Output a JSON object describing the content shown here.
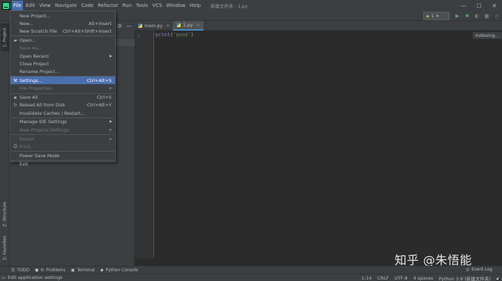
{
  "menubar": {
    "items": [
      "File",
      "Edit",
      "View",
      "Navigate",
      "Code",
      "Refactor",
      "Run",
      "Tools",
      "VCS",
      "Window",
      "Help"
    ],
    "window_title": "新建文件夹 - 1.py"
  },
  "window_controls": {
    "minimize": "—",
    "maximize": "☐",
    "close": "✕"
  },
  "toolbar": {
    "run_config": "1"
  },
  "left_tabs": {
    "project": "1: Project",
    "structure": "Z: Structure",
    "favorites": "2: Favorites"
  },
  "editor": {
    "tabs": [
      "main.py",
      "1.py"
    ],
    "line_number": "1",
    "code": {
      "fn": "print",
      "open": "(",
      "str": "'good'",
      "close": ")"
    },
    "indexing": "Indexing..."
  },
  "file_menu": [
    {
      "label": "New Project...",
      "shortcut": "",
      "icon": "",
      "disabled": false,
      "submenu": false
    },
    {
      "label": "New...",
      "shortcut": "Alt+Insert",
      "icon": "",
      "disabled": false,
      "submenu": false
    },
    {
      "label": "New Scratch File",
      "shortcut": "Ctrl+Alt+Shift+Insert",
      "icon": "",
      "disabled": false,
      "submenu": false
    },
    {
      "label": "Open...",
      "shortcut": "",
      "icon": "folder-icon",
      "disabled": false,
      "submenu": false
    },
    {
      "label": "Save As...",
      "shortcut": "",
      "icon": "",
      "disabled": true,
      "submenu": false
    },
    {
      "label": "Open Recent",
      "shortcut": "",
      "icon": "",
      "disabled": false,
      "submenu": true
    },
    {
      "label": "Close Project",
      "shortcut": "",
      "icon": "",
      "disabled": false,
      "submenu": false
    },
    {
      "label": "Rename Project...",
      "shortcut": "",
      "icon": "",
      "disabled": false,
      "submenu": false
    },
    {
      "label": "Settings...",
      "shortcut": "Ctrl+Alt+S",
      "icon": "wrench-icon",
      "disabled": false,
      "submenu": false,
      "selected": true
    },
    {
      "label": "File Properties",
      "shortcut": "",
      "icon": "",
      "disabled": true,
      "submenu": true
    },
    {
      "label": "Save All",
      "shortcut": "Ctrl+S",
      "icon": "save-icon",
      "disabled": false,
      "submenu": false
    },
    {
      "label": "Reload All from Disk",
      "shortcut": "Ctrl+Alt+Y",
      "icon": "reload-icon",
      "disabled": false,
      "submenu": false
    },
    {
      "label": "Invalidate Caches / Restart...",
      "shortcut": "",
      "icon": "",
      "disabled": false,
      "submenu": false
    },
    {
      "label": "Manage IDE Settings",
      "shortcut": "",
      "icon": "",
      "disabled": false,
      "submenu": true
    },
    {
      "label": "New Projects Settings",
      "shortcut": "",
      "icon": "",
      "disabled": true,
      "submenu": true
    },
    {
      "label": "Export",
      "shortcut": "",
      "icon": "",
      "disabled": true,
      "submenu": true
    },
    {
      "label": "Print...",
      "shortcut": "",
      "icon": "print-icon",
      "disabled": true,
      "submenu": false
    },
    {
      "label": "Power Save Mode",
      "shortcut": "",
      "icon": "",
      "disabled": false,
      "submenu": false
    },
    {
      "label": "Exit",
      "shortcut": "",
      "icon": "",
      "disabled": false,
      "submenu": false
    }
  ],
  "bottom_tabs": [
    {
      "label": "TODO",
      "icon": "list-icon"
    },
    {
      "label": "6: Problems",
      "icon": "problems-icon"
    },
    {
      "label": "Terminal",
      "icon": "terminal-icon"
    },
    {
      "label": "Python Console",
      "icon": "python-icon"
    }
  ],
  "event_log": "Event Log",
  "status": {
    "message": "Edit application settings",
    "position": "1:14",
    "line_sep": "CRLF",
    "encoding": "UTF-8",
    "indent": "4 spaces",
    "interpreter": "Python 3.8 (新建文件夹)"
  },
  "watermark": "知乎 @朱悟能",
  "colors": {
    "menu_selected": "#4b6eaf",
    "background": "#2b2b2b",
    "panel": "#3c3f41",
    "string": "#6a8759",
    "function": "#8888c6"
  }
}
